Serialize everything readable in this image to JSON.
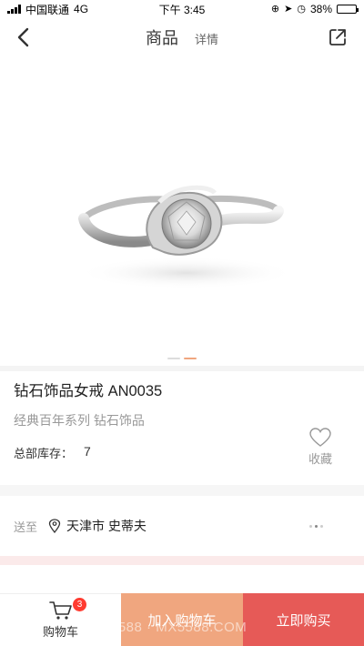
{
  "status_bar": {
    "carrier": "中国联通",
    "network": "4G",
    "time": "下午 3:45",
    "battery": "38%",
    "battery_level": 0.38
  },
  "nav": {
    "tab_product": "商品",
    "tab_detail": "详情",
    "back_icon": "chevron-left-icon",
    "share_icon": "share-icon"
  },
  "gallery": {
    "image_count": 2,
    "active_index": 1,
    "dot_active_color": "#f0a67f",
    "dot_inactive_color": "#dddddd"
  },
  "product": {
    "title": "钻石饰品女戒 AN0035",
    "subtitle": "经典百年系列 钻石饰品",
    "stock_label": "总部库存：",
    "stock_value": "7",
    "favorite_label": "收藏"
  },
  "delivery": {
    "label": "送至",
    "address": "天津市 史蒂夫"
  },
  "bottom_bar": {
    "cart_label": "购物车",
    "cart_count": "3",
    "add_to_cart": "加入购物车",
    "buy_now": "立即购买",
    "add_to_cart_color": "#f0a67f",
    "buy_now_color": "#e65a57"
  },
  "watermark": "手游5588 · MX5588.COM"
}
